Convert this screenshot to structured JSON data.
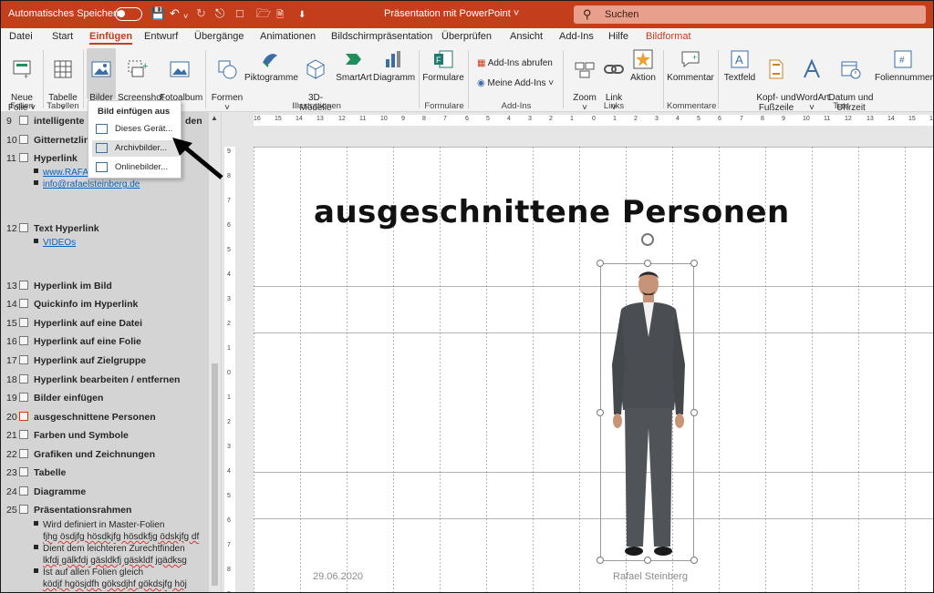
{
  "titlebar": {
    "autosave_label": "Automatisches Speichern",
    "autosave_state": "Aus",
    "document_title": "Präsentation mit PowerPoint",
    "search_placeholder": "Suchen",
    "colors": {
      "accent": "#c43e1c"
    },
    "qat_icons": [
      "save-icon",
      "undo-icon",
      "redo-icon",
      "present-icon",
      "new-icon",
      "open-icon",
      "customize-icon"
    ]
  },
  "tabs": [
    "Datei",
    "Start",
    "Einfügen",
    "Entwurf",
    "Übergänge",
    "Animationen",
    "Bildschirmpräsentation",
    "Überprüfen",
    "Ansicht",
    "Add-Ins",
    "Hilfe",
    "Bildformat"
  ],
  "active_tab": "Einfügen",
  "ribbon": {
    "neue_folie": "Neue\nFolie ˅",
    "tabelle": "Tabelle\n˅",
    "bilder": "Bilder\n˅",
    "screenshot": "Screenshot\n˅",
    "fotoalbum": "Fotoalbum\n˅",
    "formen": "Formen\n˅",
    "piktogramme": "Piktogramme",
    "modelle_3d": "3D-\nModelle ˅",
    "smartart": "SmartArt",
    "diagramm": "Diagramm",
    "formulare": "Formulare",
    "addins_abrufen": "Add-Ins abrufen",
    "meine_addins": "Meine Add-Ins ˅",
    "zoom": "Zoom\n˅",
    "link": "Link\n˅",
    "aktion": "Aktion",
    "kommentar": "Kommentar",
    "textfeld": "Textfeld",
    "kopf_fusszeile": "Kopf- und\nFußzeile",
    "wordart": "WordArt\n˅",
    "datum_uhrzeit": "Datum und\nUhrzeit",
    "foliennummer": "Foliennummer",
    "groups": {
      "folien": "Folien",
      "tabellen": "Tabellen",
      "illustrationen": "Illustrationen",
      "formulare": "Formulare",
      "addins": "Add-Ins",
      "links": "Links",
      "kommentare": "Kommentare",
      "text": "Text"
    }
  },
  "menu": {
    "header": "Bild einfügen aus",
    "items": [
      "Dieses Gerät...",
      "Archivbilder...",
      "Onlinebilder..."
    ],
    "highlighted": "Archivbilder..."
  },
  "outline": {
    "rows": [
      {
        "num": "9",
        "title": "intelligente F",
        "title_end": "den"
      },
      {
        "num": "10",
        "title": "Gitternetzlini"
      },
      {
        "num": "11",
        "title": "Hyperlink"
      },
      {
        "num": "12",
        "title": "Text Hyperlink"
      },
      {
        "num": "13",
        "title": "Hyperlink im Bild"
      },
      {
        "num": "14",
        "title": "Quickinfo im Hyperlink"
      },
      {
        "num": "15",
        "title": "Hyperlink auf eine Datei"
      },
      {
        "num": "16",
        "title": "Hyperlink auf eine Folie"
      },
      {
        "num": "17",
        "title": "Hyperlink auf Zielgruppe"
      },
      {
        "num": "18",
        "title": "Hyperlink bearbeiten / entfernen"
      },
      {
        "num": "19",
        "title": "Bilder einfügen"
      },
      {
        "num": "20",
        "title": "ausgeschnittene Personen"
      },
      {
        "num": "21",
        "title": "Farben und Symbole"
      },
      {
        "num": "22",
        "title": "Grafiken und Zeichnungen"
      },
      {
        "num": "23",
        "title": "Tabelle"
      },
      {
        "num": "24",
        "title": "Diagramme"
      },
      {
        "num": "25",
        "title": "Präsentationsrahmen"
      }
    ],
    "bullets_11": [
      "www.RAFAE",
      "info@rafaelsteinberg.de"
    ],
    "bullets_12": [
      "VIDEOs"
    ],
    "bullets_25": [
      "Wird definiert in Master-Folien",
      "fjhg ösdjfg hösdkjfg hösdkfjg ödskjfg df",
      "Dient dem leichteren Zurechtfinden",
      "lkfdj gälkfdj gäsldkfj gäskldf jgädksg",
      "Ist auf allen Folien gleich",
      "ködjf hgösjdfh göksdjhf gökdsjfg höj"
    ],
    "selected": "20"
  },
  "rulers": {
    "h_labels": [
      "16",
      "15",
      "14",
      "13",
      "12",
      "11",
      "10",
      "9",
      "8",
      "7",
      "6",
      "5",
      "4",
      "3",
      "2",
      "1",
      "0",
      "1",
      "2",
      "3",
      "4",
      "5",
      "6",
      "7",
      "8",
      "9",
      "10",
      "11",
      "12",
      "13",
      "14",
      "15",
      "16"
    ],
    "v_labels": [
      "9",
      "8",
      "7",
      "6",
      "5",
      "4",
      "3",
      "2",
      "1",
      "0",
      "1",
      "2",
      "3",
      "4",
      "5",
      "6",
      "7",
      "8",
      "9"
    ]
  },
  "slide": {
    "title": "ausgeschnittene Personen",
    "date": "29.06.2020",
    "author": "Rafael Steinberg"
  }
}
